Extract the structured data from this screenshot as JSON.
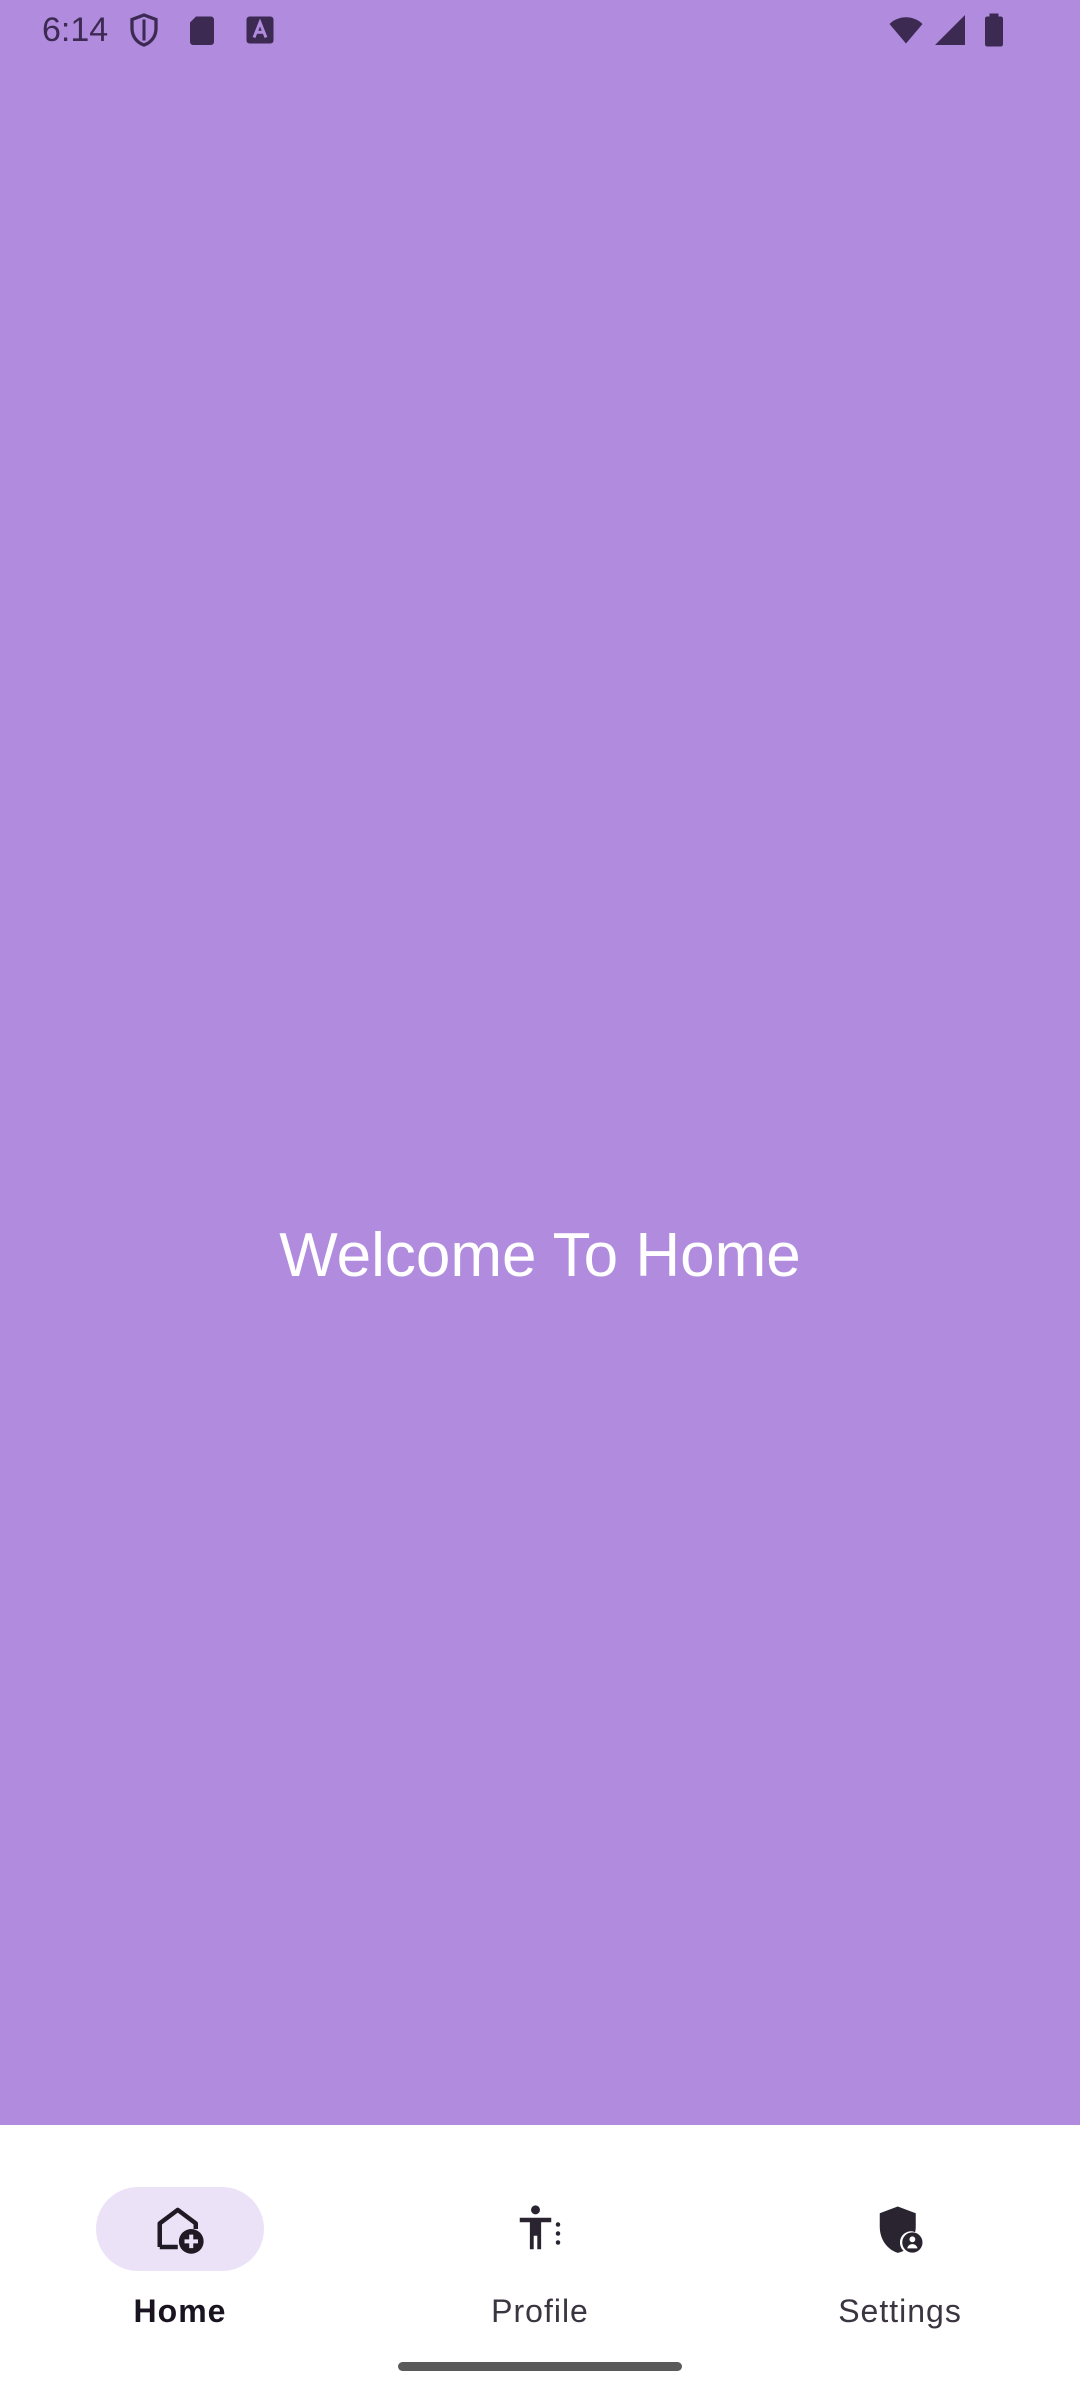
{
  "status_bar": {
    "time": "6:14",
    "left_icons": [
      "shield-icon",
      "sd-card-icon",
      "text-a-icon"
    ],
    "right_icons": [
      "wifi-icon",
      "signal-icon",
      "battery-icon"
    ]
  },
  "main": {
    "welcome_text": "Welcome To Home",
    "background_color": "#b18bdd"
  },
  "bottom_nav": {
    "items": [
      {
        "label": "Home",
        "icon": "home-add-icon",
        "active": true
      },
      {
        "label": "Profile",
        "icon": "accessibility-icon",
        "active": false
      },
      {
        "label": "Settings",
        "icon": "shield-person-icon",
        "active": false
      }
    ],
    "active_indicator_color": "#ece2f7"
  }
}
